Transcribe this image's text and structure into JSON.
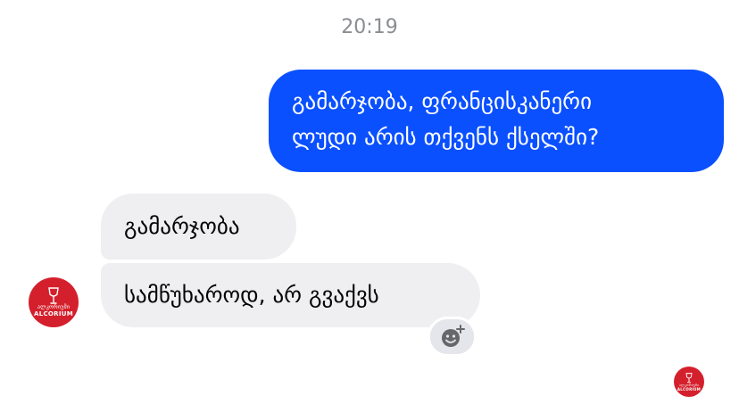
{
  "timestamp": "20:19",
  "messages": {
    "outgoing": {
      "line1": "გამარჯობა, ფრანცისკანერი",
      "line2": "ლუდი არის თქვენს ქსელში?"
    },
    "incoming": [
      {
        "text": "გამარჯობა"
      },
      {
        "text": "სამწუხაროდ, არ გვაქვს"
      }
    ]
  },
  "avatar": {
    "icon": "wine-glass-logo",
    "line1": "ალკორიუმი",
    "line2": "ALCORIUM"
  },
  "reaction_button": {
    "icon": "add-reaction-icon"
  },
  "colors": {
    "outgoing_bubble": "#0a50ff",
    "incoming_bubble": "#efeff1",
    "avatar": "#d4202c",
    "timestamp": "#8a8d91"
  }
}
